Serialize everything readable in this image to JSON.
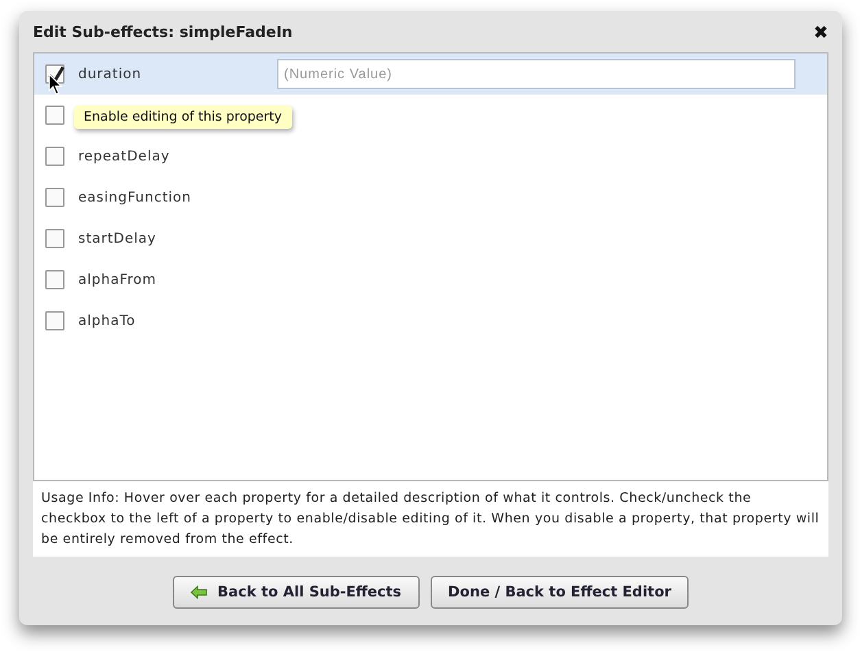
{
  "dialog": {
    "title": "Edit Sub-effects: simpleFadeIn",
    "close": "✖"
  },
  "properties": [
    {
      "label": "duration",
      "checked": true,
      "selected": true,
      "placeholder": "(Numeric Value)"
    },
    {
      "checked": false,
      "selected": false
    },
    {
      "label": "repeatDelay",
      "checked": false,
      "selected": false
    },
    {
      "label": "easingFunction",
      "checked": false,
      "selected": false
    },
    {
      "label": "startDelay",
      "checked": false,
      "selected": false
    },
    {
      "label": "alphaFrom",
      "checked": false,
      "selected": false
    },
    {
      "label": "alphaTo",
      "checked": false,
      "selected": false
    }
  ],
  "tooltip": "Enable editing of this property",
  "usage_info": "Usage Info: Hover over each property for a detailed description of what it controls.  Check/uncheck the checkbox to the left of a property to enable/disable editing of it.  When you disable a property, that property will be entirely removed from the effect.",
  "buttons": [
    {
      "kind": "back",
      "label": "Back to All Sub-Effects"
    },
    {
      "kind": "done",
      "label": "Done / Back to Effect Editor"
    }
  ]
}
